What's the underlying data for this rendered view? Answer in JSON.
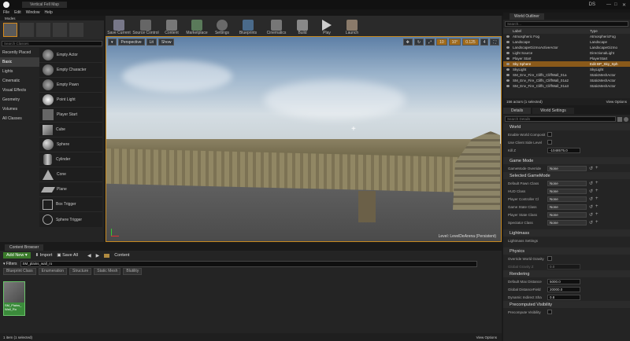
{
  "window": {
    "title": "Vertical Fell Map",
    "window_tab": "Modes",
    "min": "—",
    "max": "□",
    "close": "✕",
    "user": "DS"
  },
  "menu": [
    "File",
    "Edit",
    "Window",
    "Help"
  ],
  "modes": {
    "search_placeholder": "Search Classes",
    "categories": [
      "Recently Placed",
      "Basic",
      "Lights",
      "Cinematic",
      "Visual Effects",
      "Geometry",
      "Volumes",
      "All Classes"
    ],
    "selected": 1,
    "items": [
      "Empty Actor",
      "Empty Character",
      "Empty Pawn",
      "Point Light",
      "Player Start",
      "Cube",
      "Sphere",
      "Cylinder",
      "Cone",
      "Plane",
      "Box Trigger",
      "Sphere Trigger"
    ]
  },
  "toolbar": [
    "Save Current",
    "Source Control",
    "Content",
    "Marketplace",
    "Settings",
    "Blueprints",
    "Cinematics",
    "Build",
    "Play",
    "Launch"
  ],
  "viewport": {
    "perspective": "Perspective",
    "lit": "Lit",
    "show": "Show",
    "snap_grid": "10",
    "snap_rot": "10°",
    "snap_scale": "0.125",
    "cam_speed": "4",
    "level": "Level: LevelDeArena (Persistent)"
  },
  "outliner": {
    "tab": "World Outliner",
    "search": "Search...",
    "col_label": "Label",
    "col_type": "Type",
    "rows": [
      {
        "label": "Atmospheric Fog",
        "type": "AtmosphericFog"
      },
      {
        "label": "Landscape",
        "type": "Landscape"
      },
      {
        "label": "LandscapeGizmoActiveActor",
        "type": "LandscapeGizmo"
      },
      {
        "label": "Light Source",
        "type": "DirectionalLight"
      },
      {
        "label": "Player Start",
        "type": "PlayerStart"
      },
      {
        "label": "Sky Sphere",
        "type": "Edit BP_Sky_Sph"
      },
      {
        "label": "SkyLight",
        "type": "SkyLight"
      },
      {
        "label": "SM_Env_Fire_Cliffs_CliffWall_01a",
        "type": "StaticMeshActor"
      },
      {
        "label": "SM_Env_Fire_Cliffs_CliffWall_01a2",
        "type": "StaticMeshActor"
      },
      {
        "label": "SM_Env_Fire_Cliffs_CliffWall_01a3",
        "type": "StaticMeshActor"
      }
    ],
    "selected": 5,
    "footer": "156 actors (1 selected)",
    "view_options": "View Options"
  },
  "details": {
    "tab1": "Details",
    "tab2": "World Settings",
    "search": "Search Details",
    "world": {
      "title": "World",
      "enable_world_composition": "Enable World Composit",
      "use_client_side": "Use Client Side Level",
      "kill_z_label": "Kill Z",
      "kill_z": "-1048575.0"
    },
    "game_mode": {
      "title": "Game Mode",
      "override_label": "GameMode Override",
      "override": "None"
    },
    "selected_gm": {
      "title": "Selected GameMode",
      "fields": [
        {
          "label": "Default Pawn Class",
          "value": "None"
        },
        {
          "label": "HUD Class",
          "value": "None"
        },
        {
          "label": "Player Controller Cl",
          "value": "None"
        },
        {
          "label": "Game State Class",
          "value": "None"
        },
        {
          "label": "Player State Class",
          "value": "None"
        },
        {
          "label": "Spectator Class",
          "value": "None"
        }
      ]
    },
    "lightmass": {
      "title": "Lightmass",
      "settings": "Lightmass Settings"
    },
    "physics": {
      "title": "Physics",
      "override_gravity": "Override World Gravity",
      "global_gravity_label": "Global Gravity Z",
      "global_gravity": "0.0"
    },
    "rendering": {
      "title": "Rendering",
      "fields": [
        {
          "label": "Default Max Distance",
          "value": "5000.0"
        },
        {
          "label": "Global DistanceField",
          "value": "20000.0"
        },
        {
          "label": "Dynamic Indirect Sha",
          "value": "0.8"
        }
      ]
    },
    "precomputed": {
      "title": "Precomputed Visibility",
      "field": "Precompute Visibility"
    }
  },
  "content": {
    "tab": "Content Browser",
    "add_new": "Add New",
    "import": "Import",
    "save_all": "Save All",
    "path": "Content",
    "filters": "Filters",
    "search_value": "SM_plains_wall_ro",
    "filter_tags": [
      "Blueprint Class",
      "Enumeration",
      "Structure",
      "Static Mesh",
      "Blutility"
    ],
    "asset_label": "SM_Plains_Wall_Ro",
    "footer": "1 item (1 selected)",
    "view_options": "View Options"
  },
  "colors": {
    "accent": "#d68a1c",
    "select": "#8a5a1a",
    "add_new": "#3a7a2a"
  }
}
